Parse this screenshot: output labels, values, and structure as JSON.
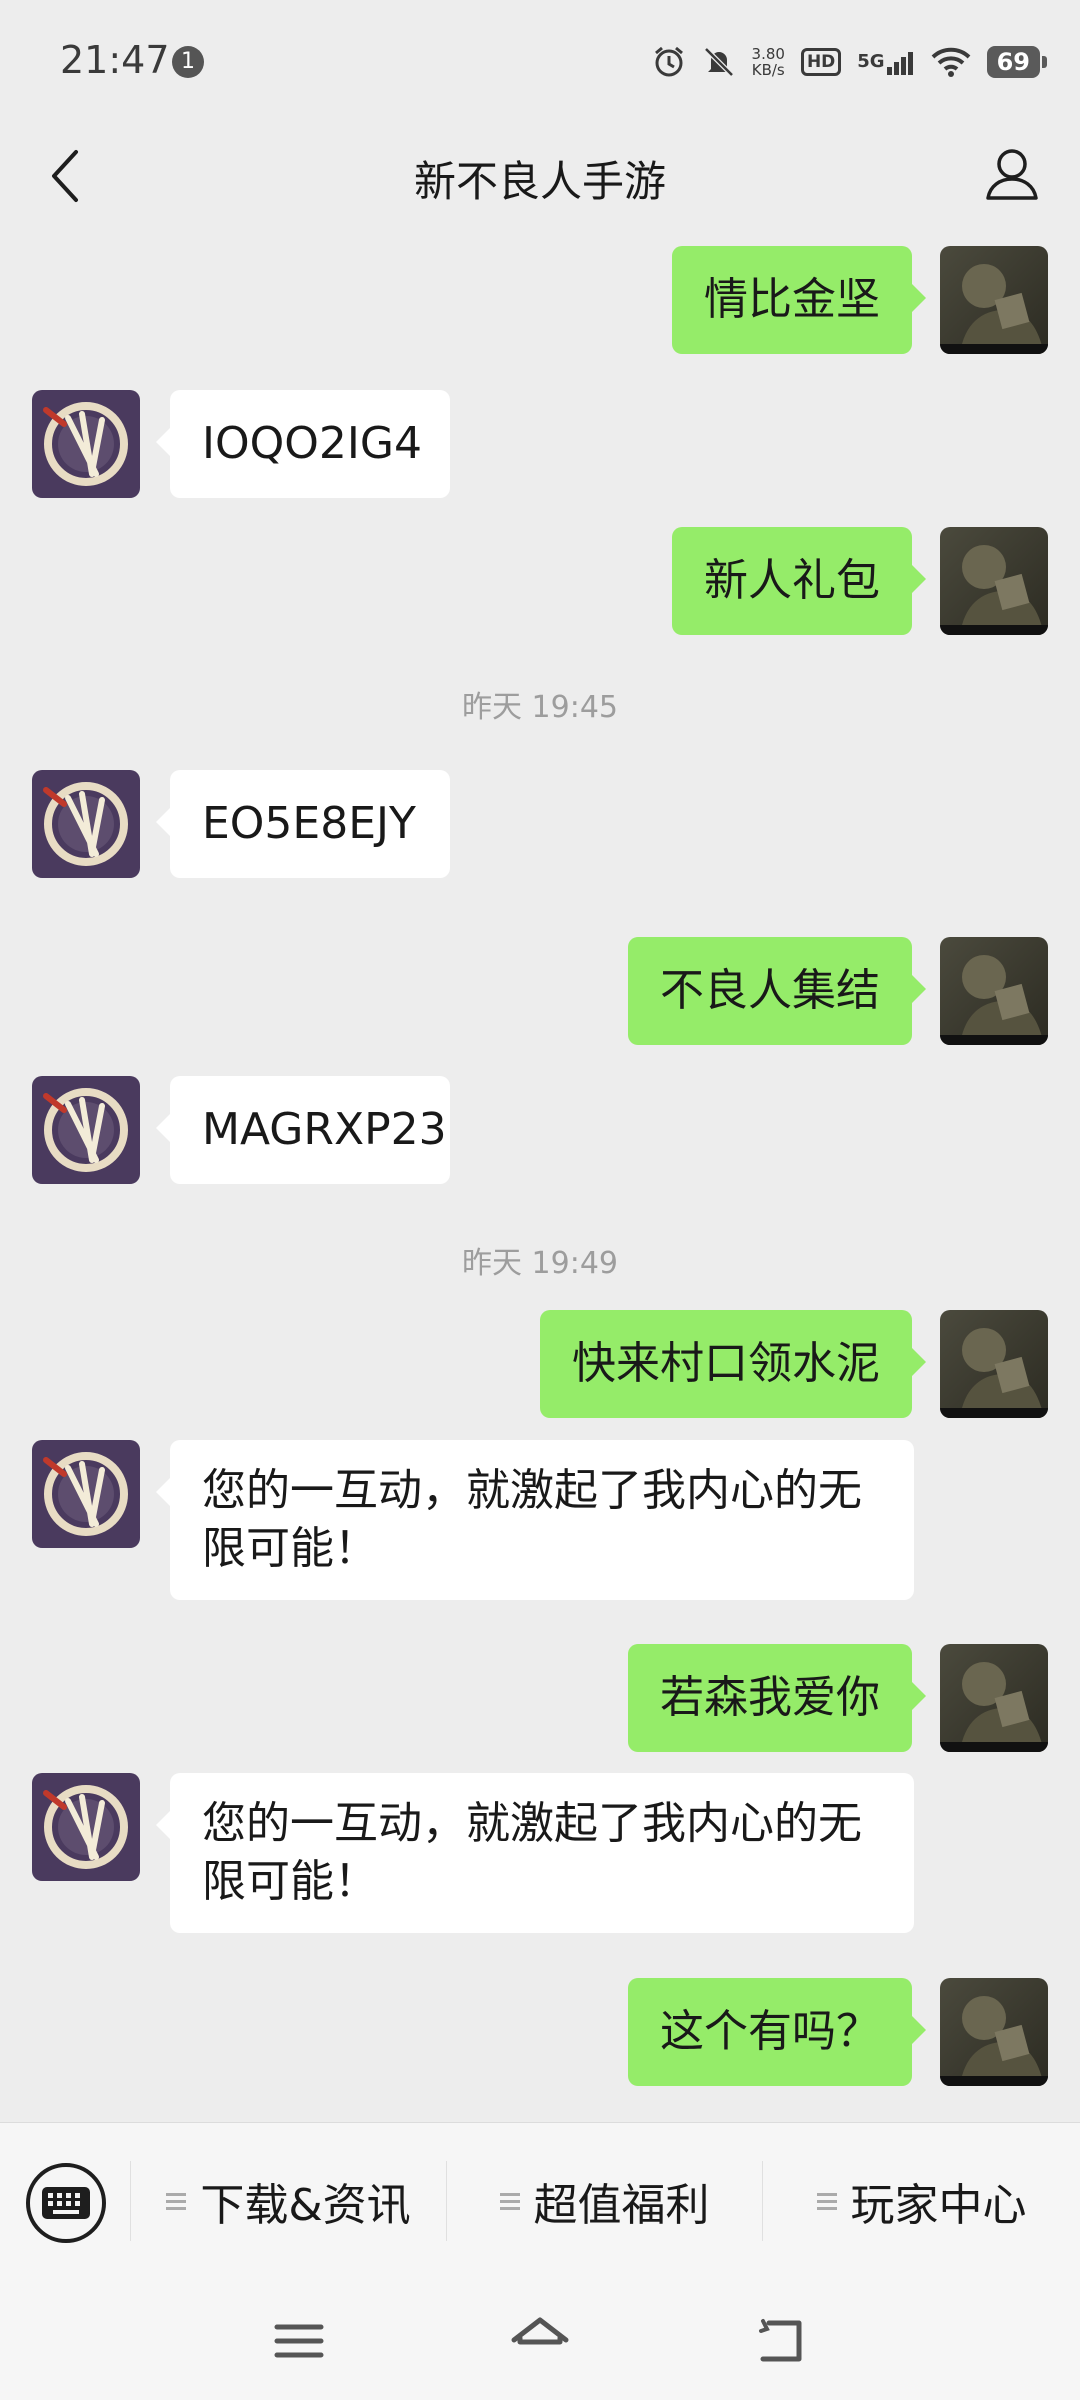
{
  "status_bar": {
    "time": "21:47",
    "notification_count": "1",
    "net_speed_value": "3.80",
    "net_speed_unit": "KB/s",
    "hd_label": "HD",
    "network_label": "5G",
    "battery": "69",
    "icons": [
      "alarm-icon",
      "mute-bell-icon",
      "signal-icon",
      "wifi-icon",
      "battery-icon"
    ]
  },
  "header": {
    "title": "新不良人手游",
    "back_icon": "chevron-left-icon",
    "profile_icon": "person-icon"
  },
  "messages": [
    {
      "side": "right",
      "text": "情比金坚"
    },
    {
      "side": "left",
      "text": "IOQO2IG4"
    },
    {
      "side": "right",
      "text": "新人礼包"
    },
    {
      "type": "time",
      "text": "昨天 19:45"
    },
    {
      "side": "left",
      "text": "EO5E8EJY"
    },
    {
      "side": "right",
      "text": "不良人集结"
    },
    {
      "side": "left",
      "text": "MAGRXP23"
    },
    {
      "type": "time",
      "text": "昨天 19:49"
    },
    {
      "side": "right",
      "text": "快来村口领水泥"
    },
    {
      "side": "left",
      "text": "您的一互动，就激起了我内心的无限可能！"
    },
    {
      "side": "right",
      "text": "若森我爱你"
    },
    {
      "side": "left",
      "text": "您的一互动，就激起了我内心的无限可能！"
    },
    {
      "side": "right",
      "text": "这个有吗？"
    }
  ],
  "menu": {
    "keyboard_icon": "keyboard-icon",
    "items": [
      "下载&资讯",
      "超值福利",
      "玩家中心"
    ]
  },
  "system_nav": [
    "menu-icon",
    "home-icon",
    "back-icon"
  ],
  "colors": {
    "background": "#ededed",
    "outgoing_bubble": "#95ec69",
    "incoming_bubble": "#ffffff",
    "timestamp": "#9d9d9d"
  }
}
